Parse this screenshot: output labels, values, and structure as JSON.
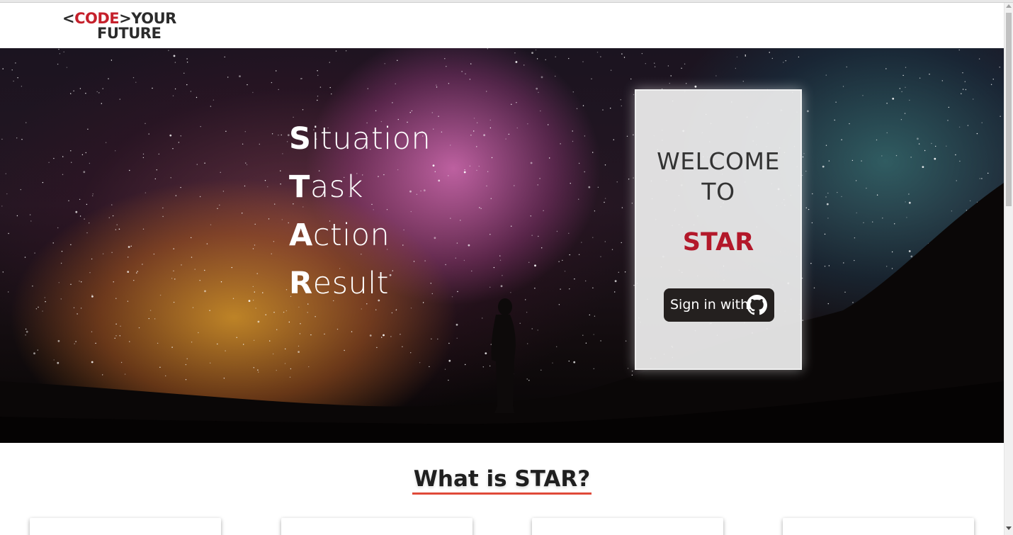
{
  "logo": {
    "bracket_open": "<",
    "code": "CODE",
    "bracket_close": ">",
    "your": "YOUR",
    "future": "FUTURE",
    "colors": {
      "code": "#c5202b",
      "dark": "#2b2b2b"
    }
  },
  "hero": {
    "star_items": [
      {
        "initial": "S",
        "rest": "ituation"
      },
      {
        "initial": "T",
        "rest": "ask"
      },
      {
        "initial": "A",
        "rest": "ction"
      },
      {
        "initial": "R",
        "rest": "esult"
      }
    ],
    "welcome": {
      "line1": "WELCOME",
      "line2": "TO",
      "app_name": "STAR",
      "signin_label": "Sign in with",
      "signin_icon": "github-icon"
    }
  },
  "section": {
    "title": "What is STAR?"
  },
  "colors": {
    "accent": "#b3182a",
    "underline": "#e04a3a",
    "button": "#24201f"
  }
}
